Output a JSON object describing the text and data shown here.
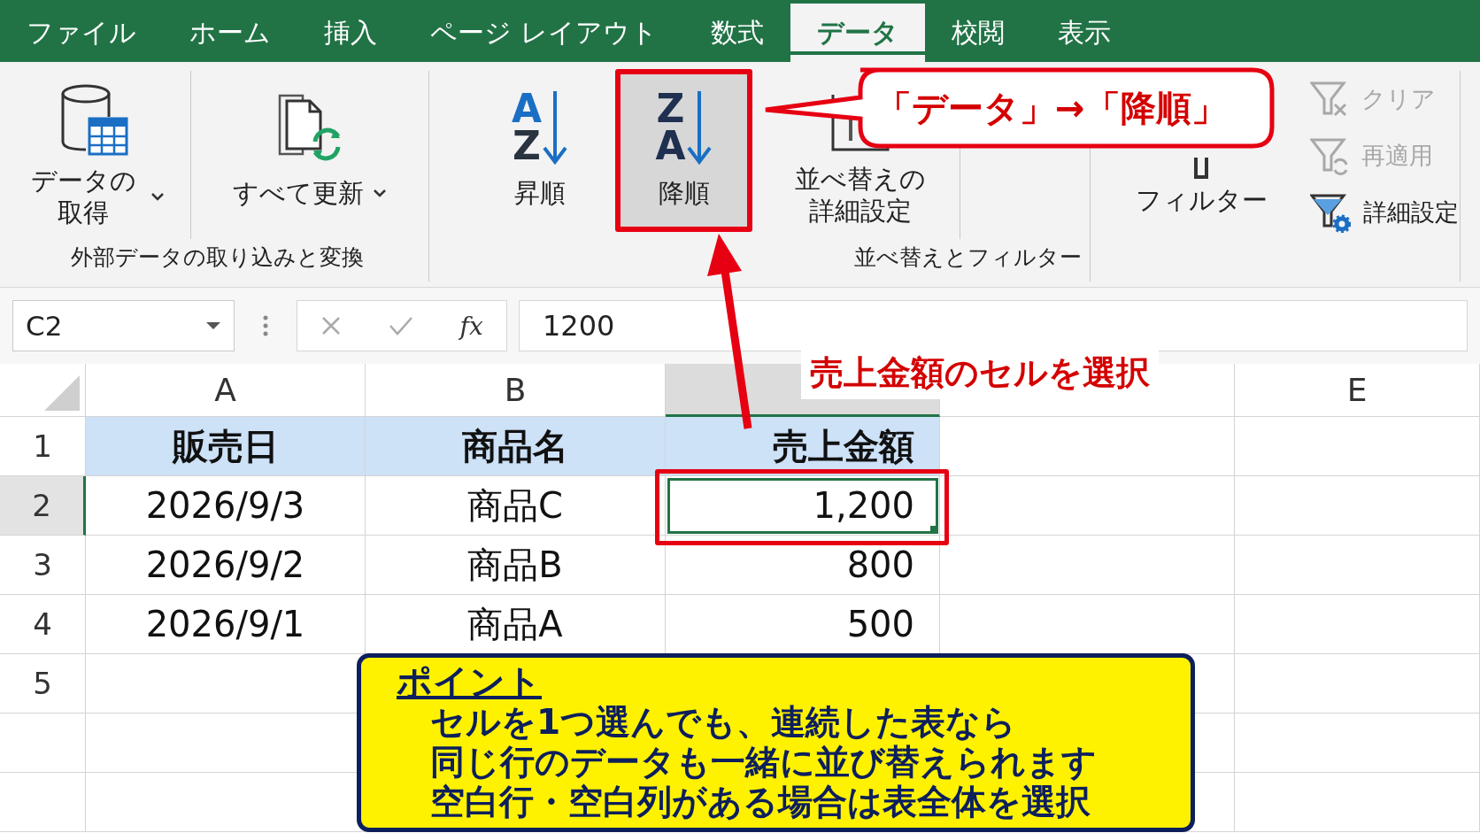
{
  "tabs": [
    {
      "label": "ファイル",
      "selected": false
    },
    {
      "label": "ホーム",
      "selected": false
    },
    {
      "label": "挿入",
      "selected": false
    },
    {
      "label": "ページ レイアウト",
      "selected": false
    },
    {
      "label": "数式",
      "selected": false
    },
    {
      "label": "データ",
      "selected": true
    },
    {
      "label": "校閲",
      "selected": false
    },
    {
      "label": "表示",
      "selected": false
    }
  ],
  "ribbon_groups": [
    {
      "label": "外部データの取り込みと変換",
      "buttons": [
        {
          "kind": "get_data",
          "label": "データの取得",
          "dropdown": true,
          "highlighted": false
        },
        {
          "kind": "refresh_all",
          "label": "すべて更新",
          "dropdown": true,
          "highlighted": false
        }
      ]
    },
    {
      "label": "並べ替えとフィルター",
      "buttons": [
        {
          "kind": "sort_asc",
          "icon_letters": [
            "A",
            "Z"
          ],
          "label": "昇順",
          "highlighted": false
        },
        {
          "kind": "sort_desc",
          "icon_letters": [
            "Z",
            "A"
          ],
          "label": "降順",
          "highlighted": true
        },
        {
          "kind": "sort_custom",
          "label": "並べ替えの詳細設定",
          "highlighted": false
        }
      ]
    },
    {
      "buttons": [
        {
          "kind": "filter",
          "label": "フィルター",
          "highlighted": false
        }
      ],
      "small_buttons": [
        {
          "kind": "clear",
          "label": "クリア",
          "disabled": true
        },
        {
          "kind": "reapply",
          "label": "再適用",
          "disabled": true
        },
        {
          "kind": "advanced",
          "label": "詳細設定",
          "disabled": false
        }
      ]
    }
  ],
  "formula_bar": {
    "name_box": "C2",
    "fx_label": "fx",
    "formula": "1200"
  },
  "sheet": {
    "columns": [
      {
        "label": "A",
        "selected": false
      },
      {
        "label": "B",
        "selected": false
      },
      {
        "selected": true
      },
      {
        "selected": false
      },
      {
        "label": "E",
        "selected": false
      }
    ],
    "rows": [
      {
        "number": "1",
        "selected": false,
        "header": true,
        "cells": [
          {
            "text": "販売日",
            "selected": false
          },
          {
            "text": "商品名",
            "selected": false
          },
          {
            "text": "売上金額",
            "selected": false
          }
        ]
      },
      {
        "number": "2",
        "selected": true,
        "header": false,
        "cells": [
          {
            "text": "2026/9/3",
            "selected": false
          },
          {
            "text": "商品C",
            "selected": false
          },
          {
            "text": "1,200",
            "selected": true
          }
        ]
      },
      {
        "number": "3",
        "selected": false,
        "header": false,
        "cells": [
          {
            "text": "2026/9/2",
            "selected": false
          },
          {
            "text": "商品B",
            "selected": false
          },
          {
            "text": "800",
            "selected": false
          }
        ]
      },
      {
        "number": "4",
        "selected": false,
        "header": false,
        "cells": [
          {
            "text": "2026/9/1",
            "selected": false
          },
          {
            "text": "商品A",
            "selected": false
          },
          {
            "text": "500",
            "selected": false
          }
        ]
      },
      {
        "number": "5",
        "selected": false
      }
    ]
  },
  "callouts": {
    "ribbon": "「データ」→「降順」",
    "cell": "売上金額のセルを選択"
  },
  "note": {
    "title": "ポイント",
    "lines": [
      "セルを1つ選んでも、連続した表なら",
      "同じ行のデータも一緒に並び替えられます",
      "空白行・空白列がある場合は表全体を選択"
    ]
  }
}
